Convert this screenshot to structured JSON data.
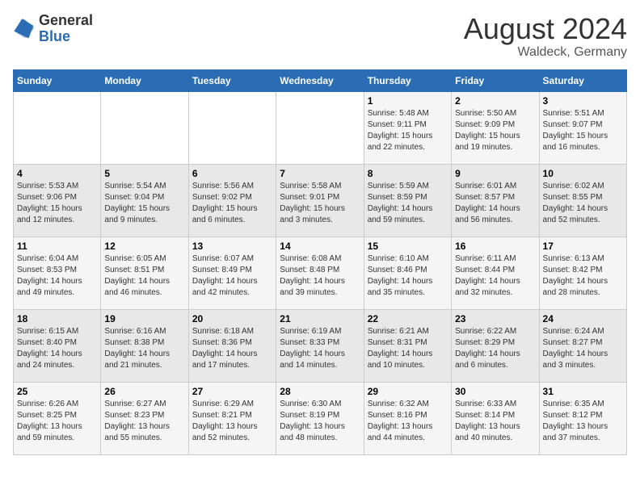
{
  "header": {
    "logo_general": "General",
    "logo_blue": "Blue",
    "month_year": "August 2024",
    "location": "Waldeck, Germany"
  },
  "calendar": {
    "days_of_week": [
      "Sunday",
      "Monday",
      "Tuesday",
      "Wednesday",
      "Thursday",
      "Friday",
      "Saturday"
    ],
    "weeks": [
      [
        {
          "day": "",
          "info": ""
        },
        {
          "day": "",
          "info": ""
        },
        {
          "day": "",
          "info": ""
        },
        {
          "day": "",
          "info": ""
        },
        {
          "day": "1",
          "info": "Sunrise: 5:48 AM\nSunset: 9:11 PM\nDaylight: 15 hours\nand 22 minutes."
        },
        {
          "day": "2",
          "info": "Sunrise: 5:50 AM\nSunset: 9:09 PM\nDaylight: 15 hours\nand 19 minutes."
        },
        {
          "day": "3",
          "info": "Sunrise: 5:51 AM\nSunset: 9:07 PM\nDaylight: 15 hours\nand 16 minutes."
        }
      ],
      [
        {
          "day": "4",
          "info": "Sunrise: 5:53 AM\nSunset: 9:06 PM\nDaylight: 15 hours\nand 12 minutes."
        },
        {
          "day": "5",
          "info": "Sunrise: 5:54 AM\nSunset: 9:04 PM\nDaylight: 15 hours\nand 9 minutes."
        },
        {
          "day": "6",
          "info": "Sunrise: 5:56 AM\nSunset: 9:02 PM\nDaylight: 15 hours\nand 6 minutes."
        },
        {
          "day": "7",
          "info": "Sunrise: 5:58 AM\nSunset: 9:01 PM\nDaylight: 15 hours\nand 3 minutes."
        },
        {
          "day": "8",
          "info": "Sunrise: 5:59 AM\nSunset: 8:59 PM\nDaylight: 14 hours\nand 59 minutes."
        },
        {
          "day": "9",
          "info": "Sunrise: 6:01 AM\nSunset: 8:57 PM\nDaylight: 14 hours\nand 56 minutes."
        },
        {
          "day": "10",
          "info": "Sunrise: 6:02 AM\nSunset: 8:55 PM\nDaylight: 14 hours\nand 52 minutes."
        }
      ],
      [
        {
          "day": "11",
          "info": "Sunrise: 6:04 AM\nSunset: 8:53 PM\nDaylight: 14 hours\nand 49 minutes."
        },
        {
          "day": "12",
          "info": "Sunrise: 6:05 AM\nSunset: 8:51 PM\nDaylight: 14 hours\nand 46 minutes."
        },
        {
          "day": "13",
          "info": "Sunrise: 6:07 AM\nSunset: 8:49 PM\nDaylight: 14 hours\nand 42 minutes."
        },
        {
          "day": "14",
          "info": "Sunrise: 6:08 AM\nSunset: 8:48 PM\nDaylight: 14 hours\nand 39 minutes."
        },
        {
          "day": "15",
          "info": "Sunrise: 6:10 AM\nSunset: 8:46 PM\nDaylight: 14 hours\nand 35 minutes."
        },
        {
          "day": "16",
          "info": "Sunrise: 6:11 AM\nSunset: 8:44 PM\nDaylight: 14 hours\nand 32 minutes."
        },
        {
          "day": "17",
          "info": "Sunrise: 6:13 AM\nSunset: 8:42 PM\nDaylight: 14 hours\nand 28 minutes."
        }
      ],
      [
        {
          "day": "18",
          "info": "Sunrise: 6:15 AM\nSunset: 8:40 PM\nDaylight: 14 hours\nand 24 minutes."
        },
        {
          "day": "19",
          "info": "Sunrise: 6:16 AM\nSunset: 8:38 PM\nDaylight: 14 hours\nand 21 minutes."
        },
        {
          "day": "20",
          "info": "Sunrise: 6:18 AM\nSunset: 8:36 PM\nDaylight: 14 hours\nand 17 minutes."
        },
        {
          "day": "21",
          "info": "Sunrise: 6:19 AM\nSunset: 8:33 PM\nDaylight: 14 hours\nand 14 minutes."
        },
        {
          "day": "22",
          "info": "Sunrise: 6:21 AM\nSunset: 8:31 PM\nDaylight: 14 hours\nand 10 minutes."
        },
        {
          "day": "23",
          "info": "Sunrise: 6:22 AM\nSunset: 8:29 PM\nDaylight: 14 hours\nand 6 minutes."
        },
        {
          "day": "24",
          "info": "Sunrise: 6:24 AM\nSunset: 8:27 PM\nDaylight: 14 hours\nand 3 minutes."
        }
      ],
      [
        {
          "day": "25",
          "info": "Sunrise: 6:26 AM\nSunset: 8:25 PM\nDaylight: 13 hours\nand 59 minutes."
        },
        {
          "day": "26",
          "info": "Sunrise: 6:27 AM\nSunset: 8:23 PM\nDaylight: 13 hours\nand 55 minutes."
        },
        {
          "day": "27",
          "info": "Sunrise: 6:29 AM\nSunset: 8:21 PM\nDaylight: 13 hours\nand 52 minutes."
        },
        {
          "day": "28",
          "info": "Sunrise: 6:30 AM\nSunset: 8:19 PM\nDaylight: 13 hours\nand 48 minutes."
        },
        {
          "day": "29",
          "info": "Sunrise: 6:32 AM\nSunset: 8:16 PM\nDaylight: 13 hours\nand 44 minutes."
        },
        {
          "day": "30",
          "info": "Sunrise: 6:33 AM\nSunset: 8:14 PM\nDaylight: 13 hours\nand 40 minutes."
        },
        {
          "day": "31",
          "info": "Sunrise: 6:35 AM\nSunset: 8:12 PM\nDaylight: 13 hours\nand 37 minutes."
        }
      ]
    ]
  }
}
